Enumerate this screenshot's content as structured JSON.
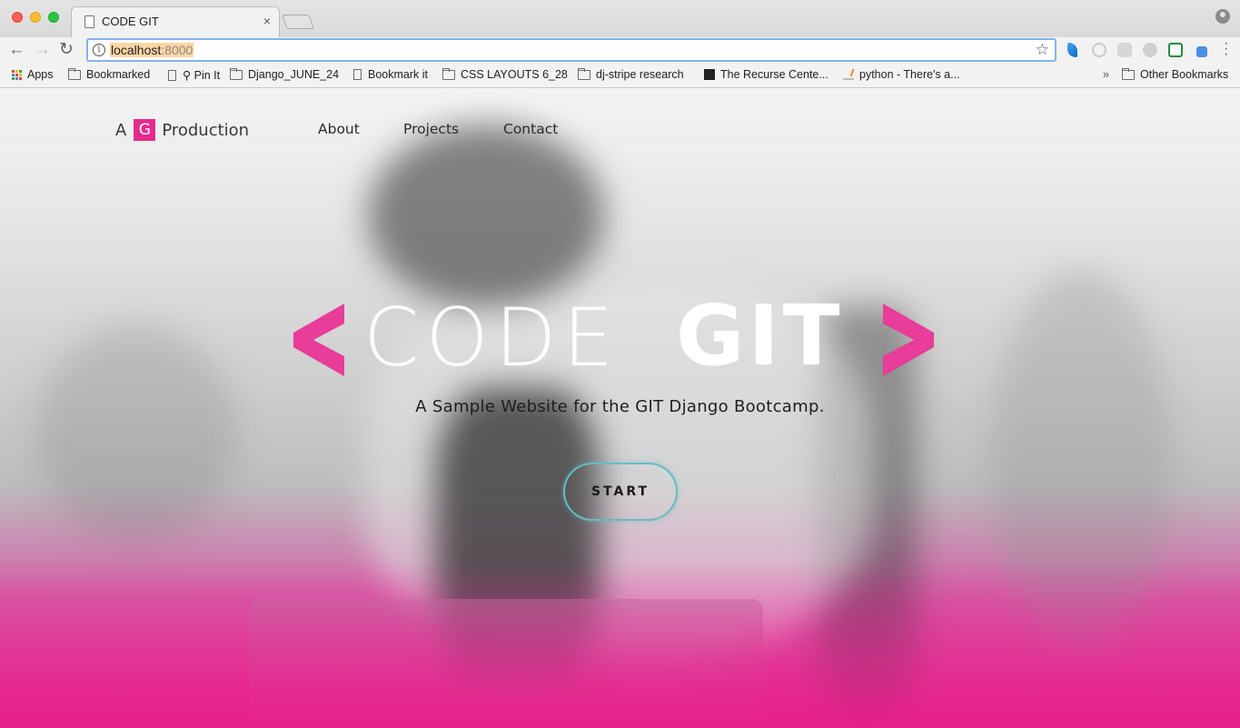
{
  "browser": {
    "tab_title": "CODE GIT",
    "tab_close": "×",
    "url_host": "localhost",
    "url_port": ":8000",
    "info_glyph": "i",
    "star_glyph": "☆",
    "back_glyph": "←",
    "forward_glyph": "→",
    "reload_glyph": "↻",
    "bookmarks": [
      {
        "label": "Apps",
        "icon": "apps-grid-icon"
      },
      {
        "label": "Bookmarked",
        "icon": "folder-icon"
      },
      {
        "label": "⚲ Pin It",
        "icon": "page-icon"
      },
      {
        "label": "Django_JUNE_24",
        "icon": "folder-icon"
      },
      {
        "label": "Bookmark it",
        "icon": "page-icon"
      },
      {
        "label": "CSS LAYOUTS 6_28",
        "icon": "folder-icon"
      },
      {
        "label": "dj-stripe research",
        "icon": "folder-icon"
      },
      {
        "label": "The Recurse Cente...",
        "icon": "recurse-center-icon"
      },
      {
        "label": "python - There's a...",
        "icon": "stackoverflow-icon"
      }
    ],
    "overflow_glyph": "»",
    "other_bookmarks": "Other Bookmarks"
  },
  "site": {
    "logo_prefix": "A",
    "logo_mark": "G",
    "logo_suffix": "Production",
    "nav": [
      "About",
      "Projects",
      "Contact"
    ],
    "hero_word_1": "CODE",
    "hero_word_2": "GIT",
    "subtitle": "A Sample Website for the GIT Django Bootcamp.",
    "cta": "START"
  },
  "colors": {
    "brand_pink": "#e62a8e",
    "cta_border": "#66bcc4",
    "omnibox_focus": "#84b2ee"
  }
}
